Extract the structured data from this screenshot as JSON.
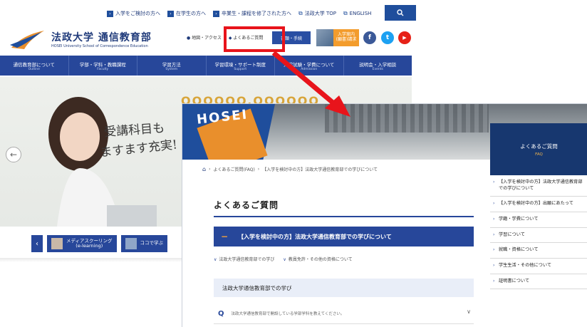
{
  "topbar": {
    "items": [
      {
        "label": "入学をご検討の方へ"
      },
      {
        "label": "在学生の方へ"
      },
      {
        "label": "卒業生・課程を修了された方へ"
      },
      {
        "label": "法政大学 TOP"
      },
      {
        "label": "ENGLISH"
      }
    ]
  },
  "logo": {
    "title": "法政大学 通信教育部",
    "subtitle": "HOSEI University School of Correspondence Education"
  },
  "header": {
    "access_label": "地図・アクセス",
    "faq_label": "よくあるご質問",
    "forms_label": "書類・手続",
    "guide_label": "入学案内\n(願書)請求",
    "social": [
      {
        "icon": "facebook-icon",
        "glyph": "f",
        "color": "#3b5998"
      },
      {
        "icon": "twitter-icon",
        "glyph": "t",
        "color": "#1da1f2"
      },
      {
        "icon": "youtube-icon",
        "glyph": "▶",
        "color": "#e62117"
      }
    ]
  },
  "mainnav": [
    {
      "jp": "通信教育部について",
      "en": "Outline"
    },
    {
      "jp": "学部・学科・教職課程",
      "en": "Faculty"
    },
    {
      "jp": "学習方法",
      "en": "System"
    },
    {
      "jp": "学習環境・サポート制度",
      "en": "Support"
    },
    {
      "jp": "入学試験・学費について",
      "en": "Admission"
    },
    {
      "jp": "説明会・入学相談",
      "en": "Events"
    }
  ],
  "hero": {
    "line1": "受講科目も",
    "line2": "ますます充実!",
    "dots": "OOOOOO.OOOOOO"
  },
  "slides": {
    "card1": "メディアスクーリング\n(e-learning)",
    "card2": "ココで学ぶ"
  },
  "inset": {
    "side_title": "よくあるご質問",
    "side_title_en": "FAQ",
    "breadcrumb": [
      "よくあるご質問(FAQ)",
      "【入学を検討中の方】法政大学通信教育部での学びについて"
    ],
    "page_title": "よくあるご質問",
    "category": "【入学を検討中の方】法政大学通信教育部での学びについて",
    "sub_links": [
      "法政大学通信教育部での学び",
      "教員免許・その他の資格について"
    ],
    "section_head": "法政大学通信教育部での学び",
    "question": "法政大学通信教育部で開設している学部学科を教えてください。",
    "side_items": [
      "【入学を検討中の方】法政大学通信教育部での学びについて",
      "【入学を検討中の方】出願にあたって",
      "学籍・学費について",
      "学習について",
      "就職・資格について",
      "学生生活・その他について",
      "証明書について"
    ]
  },
  "colors": {
    "brand_blue": "#27479a",
    "accent_orange": "#f39c2c",
    "annotation_red": "#e8141b"
  }
}
